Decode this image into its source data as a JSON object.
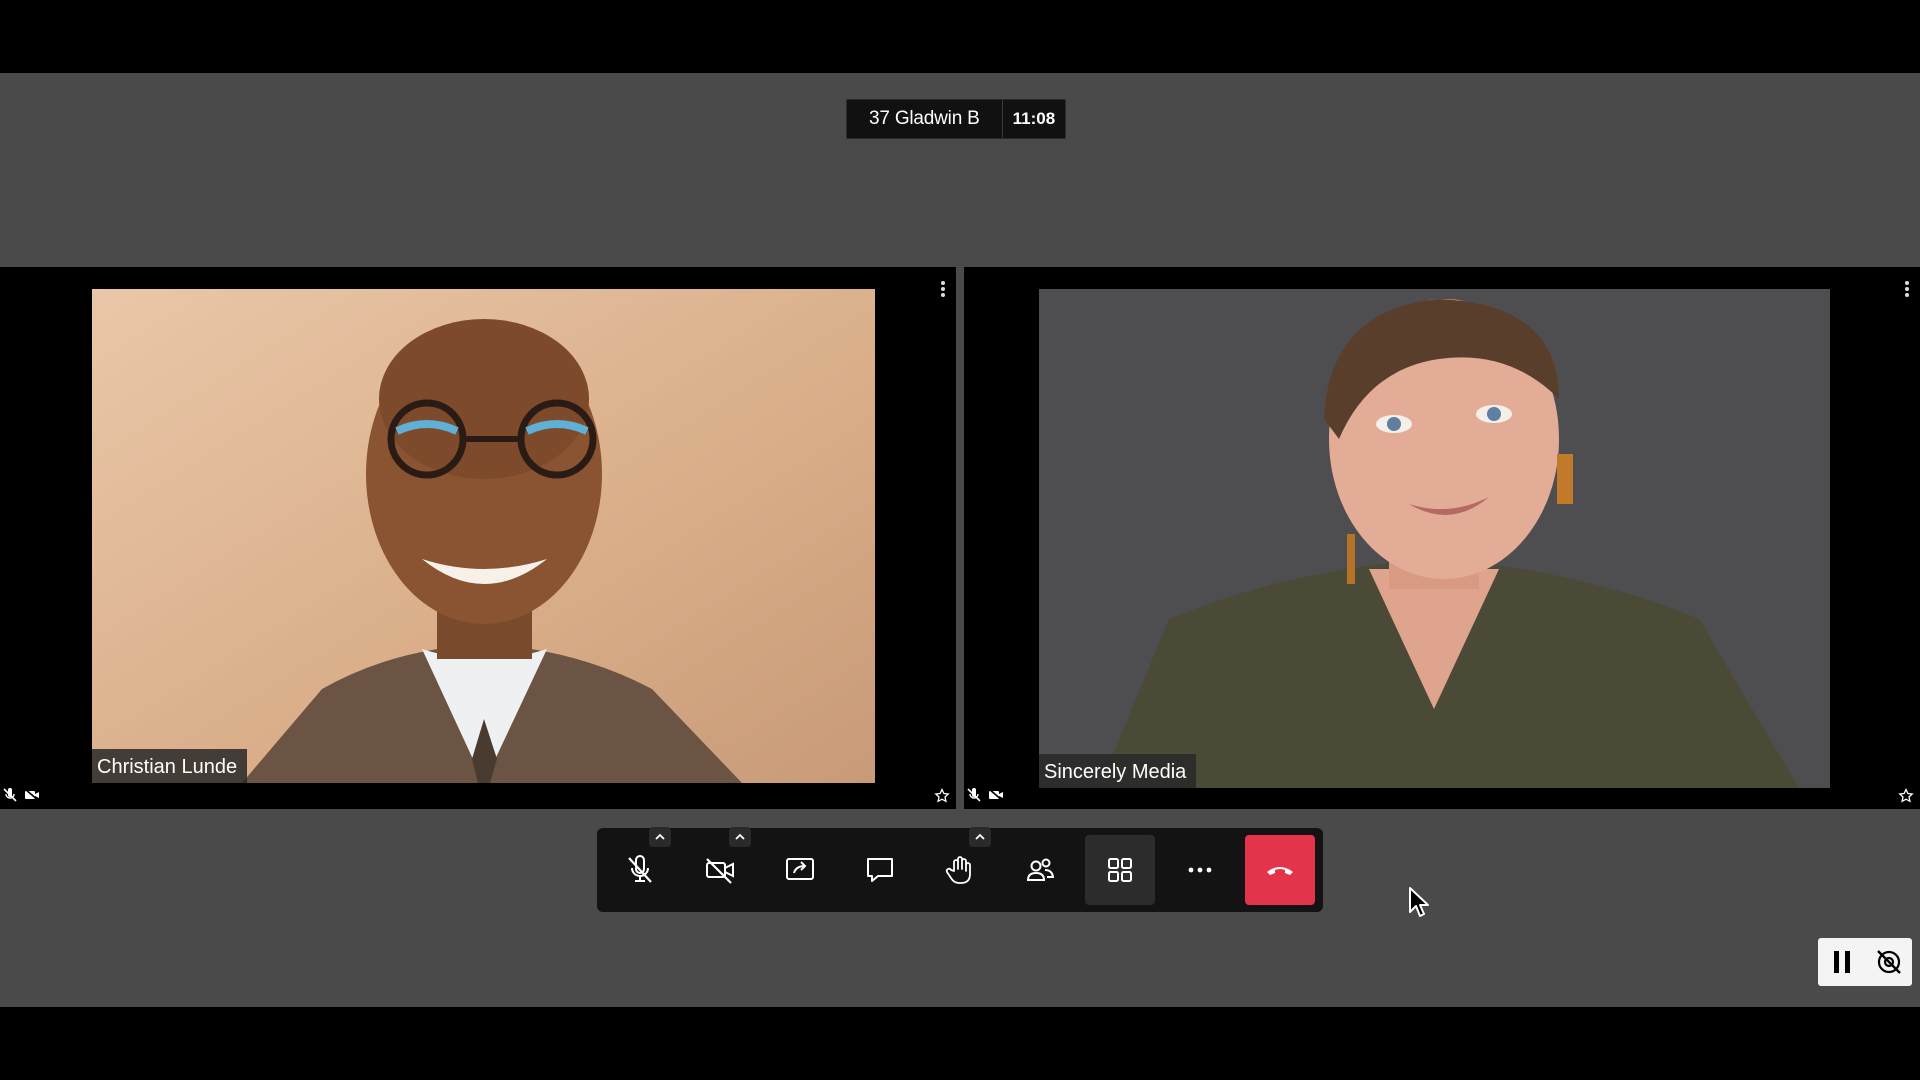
{
  "meeting": {
    "room_name": "37 Gladwin B",
    "elapsed_time": "11:08"
  },
  "participants": [
    {
      "name": "Christian Lunde",
      "mic": "muted-icon",
      "camera": "camera-off-icon"
    },
    {
      "name": "Sincerely Media",
      "mic": "muted-icon",
      "camera": "camera-off-icon"
    }
  ],
  "toolbar": {
    "buttons": [
      {
        "id": "mic",
        "icon": "microphone-muted-icon",
        "has_options": true
      },
      {
        "id": "camera",
        "icon": "camera-off-icon",
        "has_options": true
      },
      {
        "id": "share-screen",
        "icon": "screen-share-icon",
        "has_options": false
      },
      {
        "id": "chat",
        "icon": "chat-icon",
        "has_options": false
      },
      {
        "id": "raise-hand",
        "icon": "raise-hand-icon",
        "has_options": true
      },
      {
        "id": "participants",
        "icon": "participants-icon",
        "has_options": false
      },
      {
        "id": "tile-view",
        "icon": "grid-icon",
        "has_options": false,
        "active": true
      },
      {
        "id": "more",
        "icon": "more-icon",
        "has_options": false
      },
      {
        "id": "hangup",
        "icon": "hangup-icon",
        "has_options": false
      }
    ]
  },
  "colors": {
    "stage_background": "#4a4a4a",
    "hangup": "#e3344b",
    "toolbar": "#131313"
  },
  "recorder_widget": {
    "icons": [
      "pause-icon",
      "camera-off-icon"
    ]
  }
}
